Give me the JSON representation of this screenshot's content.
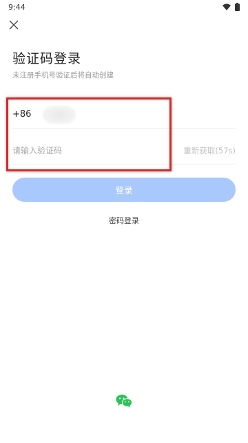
{
  "status_bar": {
    "time": "9:44",
    "icons": [
      "wifi-icon",
      "battery-icon"
    ]
  },
  "header": {
    "close_icon": "close-icon",
    "title": "验证码登录",
    "subtitle": "未注册手机号验证后将自动创建"
  },
  "form": {
    "country_code": "+86",
    "code_placeholder": "请输入验证码",
    "resend_label": "重新获取(57s)"
  },
  "actions": {
    "login_label": "登录",
    "password_login_label": "密码登录",
    "wechat_icon": "wechat-icon"
  },
  "colors": {
    "primary_disabled": "#a9c8fb",
    "highlight": "#d42a2a",
    "wechat_green": "#2dc15a"
  }
}
